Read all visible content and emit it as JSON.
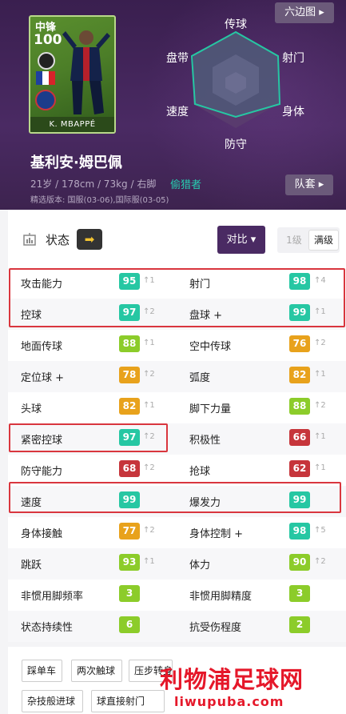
{
  "header": {
    "position": "中锋",
    "overall": "100",
    "card_name": "K. MBAPPÉ",
    "hexagon_button": "六边图 ▸",
    "player_name": "基利安·姆巴佩",
    "info": "21岁 / 178cm / 73kg / 右脚",
    "style": "偷猎者",
    "version": "精选版本: 国服(03-06),国际服(03-05)",
    "kit_button": "队套 ▸",
    "radar_labels": {
      "top": "传球",
      "top_left": "盘带",
      "top_right": "射门",
      "bottom_left": "速度",
      "bottom_right": "身体",
      "bottom": "防守"
    }
  },
  "status": {
    "label": "状态",
    "arrow": "➡",
    "compare_button": "对比 ▾",
    "level_1": "1级",
    "level_max": "满级"
  },
  "colors": {
    "teal": "#26c7a3",
    "green": "#8ccc2a",
    "orange": "#e8a21c",
    "red": "#c6353b",
    "purple": "#4a2a63"
  },
  "stats": [
    [
      {
        "label": "攻击能力",
        "value": "95",
        "delta": "↑1",
        "color": "teal"
      },
      {
        "label": "射门",
        "value": "98",
        "delta": "↑4",
        "color": "teal"
      }
    ],
    [
      {
        "label": "控球",
        "value": "97",
        "delta": "↑2",
        "color": "teal"
      },
      {
        "label": "盘球 +",
        "value": "99",
        "delta": "↑1",
        "color": "teal"
      }
    ],
    [
      {
        "label": "地面传球",
        "value": "88",
        "delta": "↑1",
        "color": "green"
      },
      {
        "label": "空中传球",
        "value": "76",
        "delta": "↑2",
        "color": "orange"
      }
    ],
    [
      {
        "label": "定位球 +",
        "value": "78",
        "delta": "↑2",
        "color": "orange"
      },
      {
        "label": "弧度",
        "value": "82",
        "delta": "↑1",
        "color": "orange"
      }
    ],
    [
      {
        "label": "头球",
        "value": "82",
        "delta": "↑1",
        "color": "orange"
      },
      {
        "label": "脚下力量",
        "value": "88",
        "delta": "↑2",
        "color": "green"
      }
    ],
    [
      {
        "label": "紧密控球",
        "value": "97",
        "delta": "↑2",
        "color": "teal"
      },
      {
        "label": "积极性",
        "value": "66",
        "delta": "↑1",
        "color": "red"
      }
    ],
    [
      {
        "label": "防守能力",
        "value": "68",
        "delta": "↑2",
        "color": "red"
      },
      {
        "label": "抢球",
        "value": "62",
        "delta": "↑1",
        "color": "red"
      }
    ],
    [
      {
        "label": "速度",
        "value": "99",
        "delta": "",
        "color": "teal"
      },
      {
        "label": "爆发力",
        "value": "99",
        "delta": "",
        "color": "teal"
      }
    ],
    [
      {
        "label": "身体接触",
        "value": "77",
        "delta": "↑2",
        "color": "orange"
      },
      {
        "label": "身体控制 +",
        "value": "98",
        "delta": "↑5",
        "color": "teal"
      }
    ],
    [
      {
        "label": "跳跃",
        "value": "93",
        "delta": "↑1",
        "color": "green"
      },
      {
        "label": "体力",
        "value": "90",
        "delta": "↑2",
        "color": "green"
      }
    ],
    [
      {
        "label": "非惯用脚频率",
        "value": "3",
        "delta": "",
        "color": "green"
      },
      {
        "label": "非惯用脚精度",
        "value": "3",
        "delta": "",
        "color": "green"
      }
    ],
    [
      {
        "label": "状态持续性",
        "value": "6",
        "delta": "",
        "color": "green"
      },
      {
        "label": "抗受伤程度",
        "value": "2",
        "delta": "",
        "color": "green"
      }
    ]
  ],
  "skills": [
    "踩单车",
    "两次触球",
    "压步转身",
    "杂技般进球",
    "球直接射门"
  ],
  "watermark": {
    "main": "利物浦足球网",
    "sub": "liwupuba.com"
  }
}
